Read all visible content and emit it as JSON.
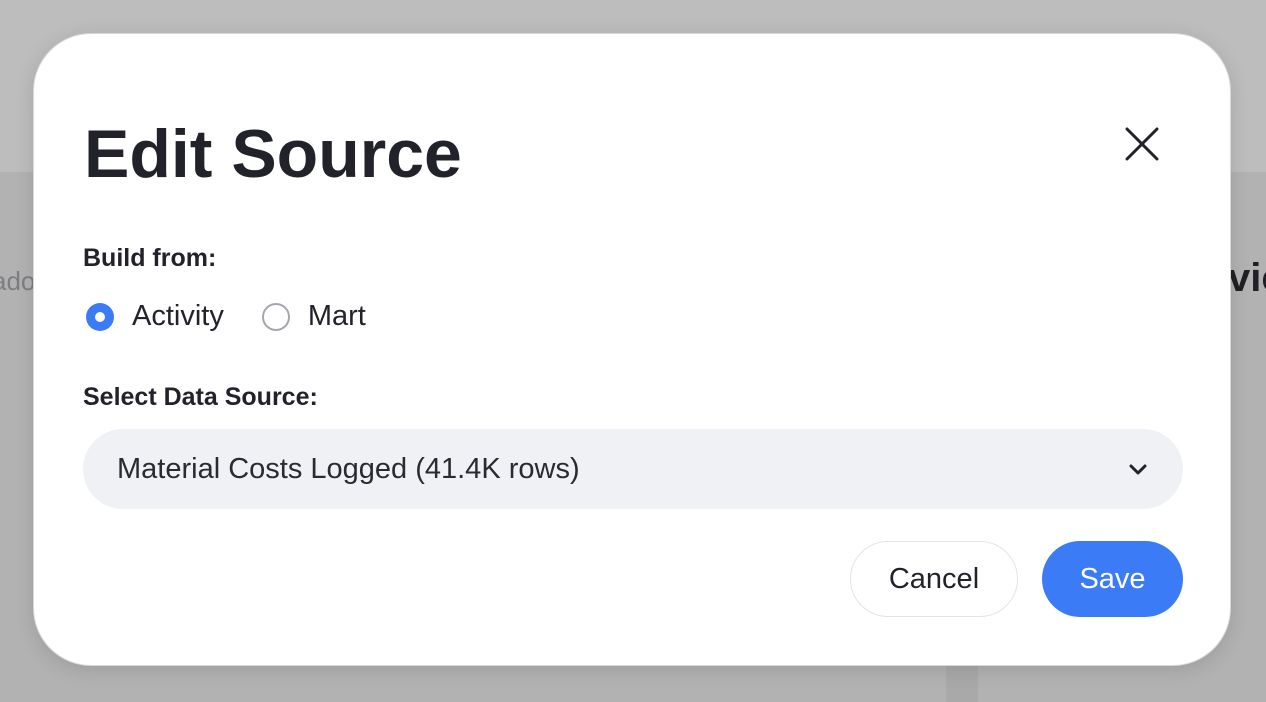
{
  "background": {
    "left_text_fragment": "ado",
    "right_text_fragment": "vic"
  },
  "modal": {
    "title": "Edit Source",
    "close_icon": "close-icon",
    "build_from_label": "Build from:",
    "build_options": [
      {
        "label": "Activity",
        "selected": true
      },
      {
        "label": "Mart",
        "selected": false
      }
    ],
    "data_source_label": "Select Data Source:",
    "data_source_value": "Material Costs Logged (41.4K rows)",
    "cancel_label": "Cancel",
    "save_label": "Save",
    "accent_color": "#3b7bf6"
  }
}
